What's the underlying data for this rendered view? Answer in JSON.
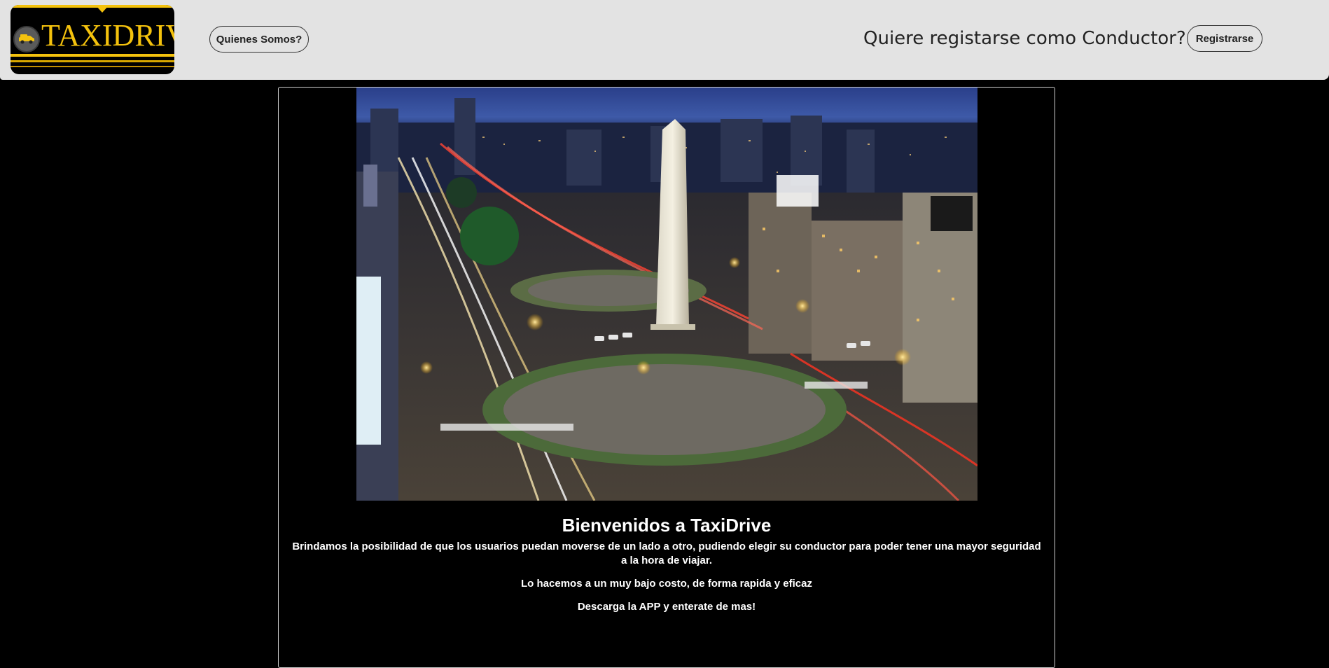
{
  "header": {
    "logo_text": "TAXIDRIVE",
    "about_button": "Quienes Somos?",
    "driver_prompt": "Quiere registarse como Conductor?",
    "register_button": "Registrarse"
  },
  "hero": {
    "image_label": "Buenos Aires obelisk at night"
  },
  "main": {
    "title": "Bienvenidos a TaxiDrive",
    "paragraphs": [
      "Brindamos la posibilidad de que los usuarios puedan moverse de un lado a otro, pudiendo elegir su conductor para poder tener una mayor seguridad a la hora de viajar.",
      "Lo hacemos a un muy bajo costo, de forma rapida y eficaz",
      "Descarga la APP y enterate de mas!"
    ]
  },
  "colors": {
    "brand_yellow": "#f4c20d",
    "navbar_bg": "#e3e3e3",
    "page_bg": "#000000"
  }
}
